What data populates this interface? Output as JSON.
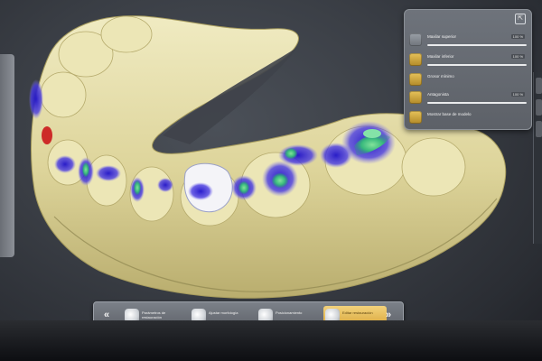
{
  "visibility_panel": {
    "rows": [
      {
        "label": "Maxilar superior",
        "icon": "upper-jaw-icon",
        "percent": "100 %",
        "level": 1.0
      },
      {
        "label": "Maxilar inferior",
        "icon": "lower-jaw-icon",
        "percent": "100 %",
        "level": 1.0
      },
      {
        "label": "Grosor mínimo",
        "icon": "thickness-icon"
      },
      {
        "label": "Antagonista",
        "icon": "antagonist-icon",
        "percent": "100 %",
        "level": 1.0
      },
      {
        "label": "Mostrar base de modelo",
        "icon": "model-base-icon"
      }
    ]
  },
  "workflow": {
    "steps": [
      {
        "label": "Parámetros de restauración"
      },
      {
        "label": "Ajustar morfología"
      },
      {
        "label": "Posicionamiento"
      },
      {
        "label": "Editar restauración"
      }
    ],
    "active_step": 3
  },
  "colors": {
    "model": "#e6e0ab",
    "contact_blue": "#3b2fd0",
    "contact_green": "#3cc47a",
    "accent": "#e0b54c"
  }
}
